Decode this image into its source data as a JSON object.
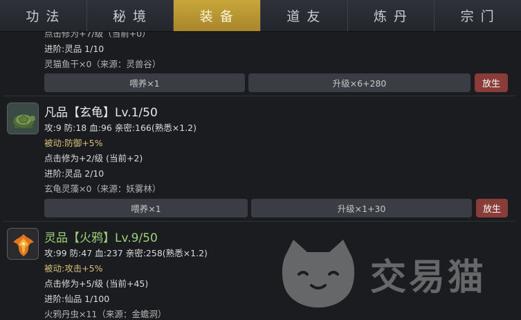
{
  "tabs": [
    {
      "label": "功 法"
    },
    {
      "label": "秘 境"
    },
    {
      "label": "装 备"
    },
    {
      "label": "道 友"
    },
    {
      "label": "炼 丹"
    },
    {
      "label": "宗 门"
    }
  ],
  "pets": [
    {
      "partial_top": "点击修为+7/级（当前+0）",
      "advance": "进阶:灵品 1/10",
      "material": "灵猫鱼干×0（来源：灵兽谷）",
      "feed_label": "喂养×1",
      "upgrade_label": "升级×6+280",
      "release_label": "放生"
    },
    {
      "name": "凡品【玄龟】Lv.1/50",
      "stats": "攻:9 防:18 血:96  亲密:166(熟悉×1.2)",
      "passive": "被动:防御+5%",
      "click": "点击修为+2/级 (当前+2)",
      "advance": "进阶:灵品 2/10",
      "material": "玄龟灵藻×0（来源：妖雾林）",
      "feed_label": "喂养×1",
      "upgrade_label": "升级×1+30",
      "release_label": "放生",
      "icon": "turtle-icon"
    },
    {
      "name": "灵品【火鸦】Lv.9/50",
      "stats": "攻:99 防:47 血:237  亲密:258(熟悉×1.2)",
      "passive": "被动:攻击+5%",
      "click": "点击修为+5/级 (当前+45)",
      "advance": "进阶:仙品 1/100",
      "material": "火鸦丹虫×11（来源：金蟾洞）",
      "icon": "fire-crow-icon"
    }
  ],
  "watermark": {
    "text": "交易猫",
    "icon": "cat-logo"
  }
}
